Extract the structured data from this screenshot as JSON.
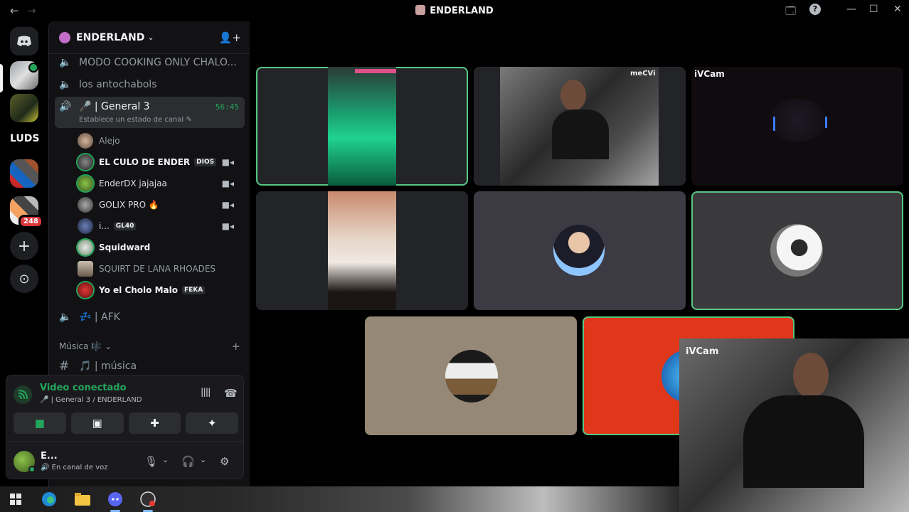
{
  "window": {
    "title": "ENDERLAND",
    "back_icon": "←",
    "forward_icon": "→",
    "inbox_icon": "🗔",
    "help_icon": "?",
    "minimize_icon": "—",
    "maximize_icon": "☐",
    "close_icon": "✕"
  },
  "rail": {
    "home_icon": "discord-logo",
    "ludo_label": "LUDS",
    "unread_badge": "248",
    "add_icon": "+",
    "discover_icon": "⊙"
  },
  "server": {
    "name": "ENDERLAND",
    "chevron": "⌄",
    "invite_icon": "👤+"
  },
  "channels": [
    {
      "name": "MODO COOKING ONLY CHALO..."
    },
    {
      "name": "los antochabols"
    },
    {
      "name": "🎤 | General 3",
      "timer": "56:45",
      "status": "Establece un estado de canal ✎"
    },
    {
      "name": "💤 | AFK"
    }
  ],
  "members": [
    {
      "name": "Alejo",
      "tag": "",
      "cam": false
    },
    {
      "name": "EL CULO DE ENDER",
      "tag": "DIOS",
      "cam": true
    },
    {
      "name": "EnderDX jajajaa",
      "tag": "",
      "cam": true
    },
    {
      "name": "GOLIX PRO 🔥",
      "tag": "",
      "cam": true
    },
    {
      "name": "i...",
      "tag": "GL40",
      "cam": true
    },
    {
      "name": "Squidward",
      "tag": "",
      "cam": false
    },
    {
      "name": "SQUIRT DE LANA RHOADES",
      "tag": "",
      "cam": false
    },
    {
      "name": "Yo el Cholo Malo",
      "tag": "FEKA",
      "cam": false
    }
  ],
  "category": {
    "name": "Música 🎼",
    "chevron": "⌄",
    "add": "+",
    "text_channel": "🎵 | música",
    "hash": "#"
  },
  "voice": {
    "status": "Video conectado",
    "location": "🎤 | General 3 / ENDERLAND",
    "signal_icon": "📶",
    "soundboard_icon": "||||",
    "disconnect_icon": "☎",
    "camera_icon": "■",
    "screen_icon": "▣",
    "activity_icon": "✚",
    "effects_icon": "✦"
  },
  "user": {
    "name": "E...",
    "status": "🔊 En canal de voz",
    "mic_icon": "🎙",
    "headset_icon": "🎧",
    "settings_icon": "⚙",
    "chevron": "⌄"
  },
  "tiles": [
    {
      "label": "",
      "speaking": true
    },
    {
      "label": "meCVi",
      "speaking": false
    },
    {
      "label": "iVCam",
      "speaking": false
    },
    {
      "label": "",
      "speaking": false
    },
    {
      "label": "",
      "speaking": false
    },
    {
      "label": "",
      "speaking": true
    },
    {
      "label": "",
      "speaking": false
    },
    {
      "label": "",
      "speaking": true
    }
  ],
  "pip": {
    "label": "iVCam"
  },
  "colors": {
    "accent_green": "#23a55a",
    "speaking_ring": "#57c783",
    "bg": "#000000"
  }
}
